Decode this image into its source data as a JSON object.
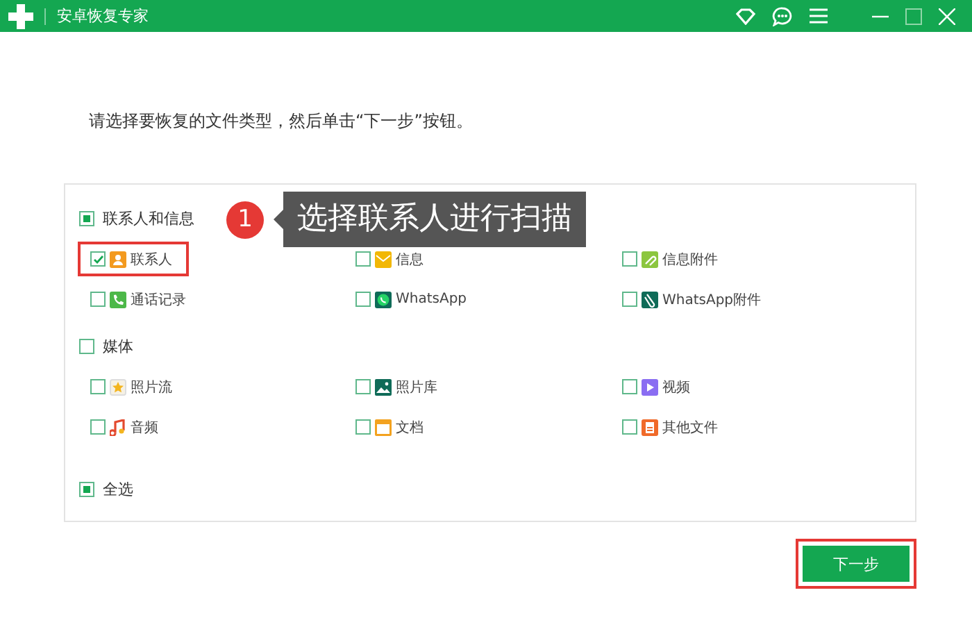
{
  "window": {
    "title": "安卓恢复专家"
  },
  "instruction": "请选择要恢复的文件类型，然后单击“下一步”按钮。",
  "groups": [
    {
      "label": "联系人和信息",
      "mixed": true,
      "items": [
        {
          "label": "联系人",
          "kind": "contacts",
          "checked": true,
          "highlighted": true
        },
        {
          "label": "信息",
          "kind": "messages",
          "checked": false,
          "highlighted": false
        },
        {
          "label": "信息附件",
          "kind": "attachment",
          "checked": false,
          "highlighted": false
        },
        {
          "label": "通话记录",
          "kind": "calls",
          "checked": false,
          "highlighted": false
        },
        {
          "label": "WhatsApp",
          "kind": "whatsapp",
          "checked": false,
          "highlighted": false
        },
        {
          "label": "WhatsApp附件",
          "kind": "clip",
          "checked": false,
          "highlighted": false
        }
      ]
    },
    {
      "label": "媒体",
      "mixed": false,
      "items": [
        {
          "label": "照片流",
          "kind": "star",
          "checked": false,
          "highlighted": false
        },
        {
          "label": "照片库",
          "kind": "photo",
          "checked": false,
          "highlighted": false
        },
        {
          "label": "视频",
          "kind": "video",
          "checked": false,
          "highlighted": false
        },
        {
          "label": "音频",
          "kind": "audio",
          "checked": false,
          "highlighted": false
        },
        {
          "label": "文档",
          "kind": "folder",
          "checked": false,
          "highlighted": false
        },
        {
          "label": "其他文件",
          "kind": "file",
          "checked": false,
          "highlighted": false
        }
      ]
    }
  ],
  "select_all": {
    "label": "全选",
    "mixed": true
  },
  "tooltip": {
    "step": "1",
    "text": "选择联系人进行扫描"
  },
  "next_button": {
    "label": "下一步",
    "highlighted": true
  }
}
